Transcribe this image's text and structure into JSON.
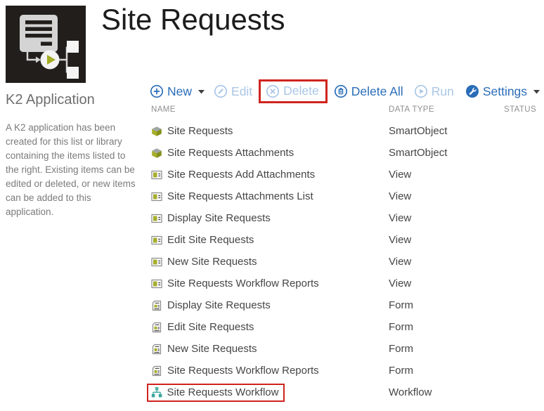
{
  "app": {
    "title": "Site Requests"
  },
  "sidebar": {
    "heading": "K2 Application",
    "description": "A K2 application has been created for this list or library containing the items listed to the right. Existing items can be edited or deleted, or new items can be added to this application."
  },
  "toolbar": {
    "new": {
      "label": "New",
      "enabled": true,
      "has_dropdown": true
    },
    "edit": {
      "label": "Edit",
      "enabled": false
    },
    "delete": {
      "label": "Delete",
      "enabled": false,
      "annotated": true
    },
    "delete_all": {
      "label": "Delete All",
      "enabled": true
    },
    "run": {
      "label": "Run",
      "enabled": false
    },
    "settings": {
      "label": "Settings",
      "enabled": true,
      "has_dropdown": true
    }
  },
  "table": {
    "columns": {
      "name": "NAME",
      "data_type": "DATA TYPE",
      "status": "STATUS"
    },
    "rows": [
      {
        "name": "Site Requests",
        "data_type": "SmartObject",
        "status": "",
        "icon": "smartobject-icon"
      },
      {
        "name": "Site Requests Attachments",
        "data_type": "SmartObject",
        "status": "",
        "icon": "smartobject-icon"
      },
      {
        "name": "Site Requests Add Attachments",
        "data_type": "View",
        "status": "",
        "icon": "view-icon"
      },
      {
        "name": "Site Requests Attachments List",
        "data_type": "View",
        "status": "",
        "icon": "view-icon"
      },
      {
        "name": "Display Site Requests",
        "data_type": "View",
        "status": "",
        "icon": "view-icon"
      },
      {
        "name": "Edit Site Requests",
        "data_type": "View",
        "status": "",
        "icon": "view-icon"
      },
      {
        "name": "New Site Requests",
        "data_type": "View",
        "status": "",
        "icon": "view-icon"
      },
      {
        "name": "Site Requests Workflow Reports",
        "data_type": "View",
        "status": "",
        "icon": "view-icon"
      },
      {
        "name": "Display Site Requests",
        "data_type": "Form",
        "status": "",
        "icon": "form-icon"
      },
      {
        "name": "Edit Site Requests",
        "data_type": "Form",
        "status": "",
        "icon": "form-icon"
      },
      {
        "name": "New Site Requests",
        "data_type": "Form",
        "status": "",
        "icon": "form-icon"
      },
      {
        "name": "Site Requests Workflow Reports",
        "data_type": "Form",
        "status": "",
        "icon": "form-icon"
      },
      {
        "name": "Site Requests Workflow",
        "data_type": "Workflow",
        "status": "",
        "icon": "workflow-icon",
        "annotated": true
      }
    ]
  },
  "colors": {
    "accent_blue": "#2a6db8",
    "disabled_blue": "#a9c6e6",
    "annotation_red": "#cf241e",
    "smartobject_olive": "#a6ae2c",
    "workflow_teal": "#3aa79d",
    "logo_background": "#211e1b"
  }
}
